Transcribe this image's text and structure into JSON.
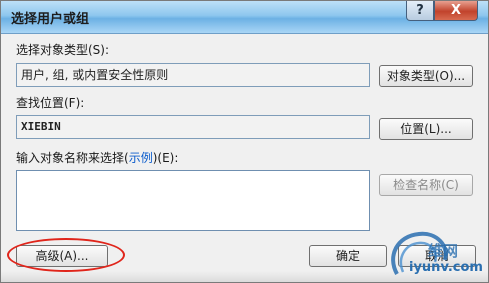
{
  "window": {
    "title": "选择用户或组",
    "help_button": "?",
    "close_button": "X"
  },
  "object_type": {
    "label": "选择对象类型(S):",
    "value": "用户, 组, 或内置安全性原则",
    "button": "对象类型(O)..."
  },
  "location": {
    "label": "查找位置(F):",
    "value": "XIEBIN",
    "button": "位置(L)..."
  },
  "names": {
    "label_before": "输入对象名称来选择(",
    "label_link": "示例",
    "label_after": ")(E):",
    "value": "",
    "check_button": "检查名称(C)"
  },
  "footer": {
    "advanced_button": "高级(A)...",
    "ok_button": "确定",
    "cancel_button": "取消"
  },
  "watermark": {
    "text_top": "维网",
    "text_bottom": "iyunv.com"
  },
  "colors": {
    "highlight_ring": "#e0251b",
    "link": "#0b5ccc"
  }
}
